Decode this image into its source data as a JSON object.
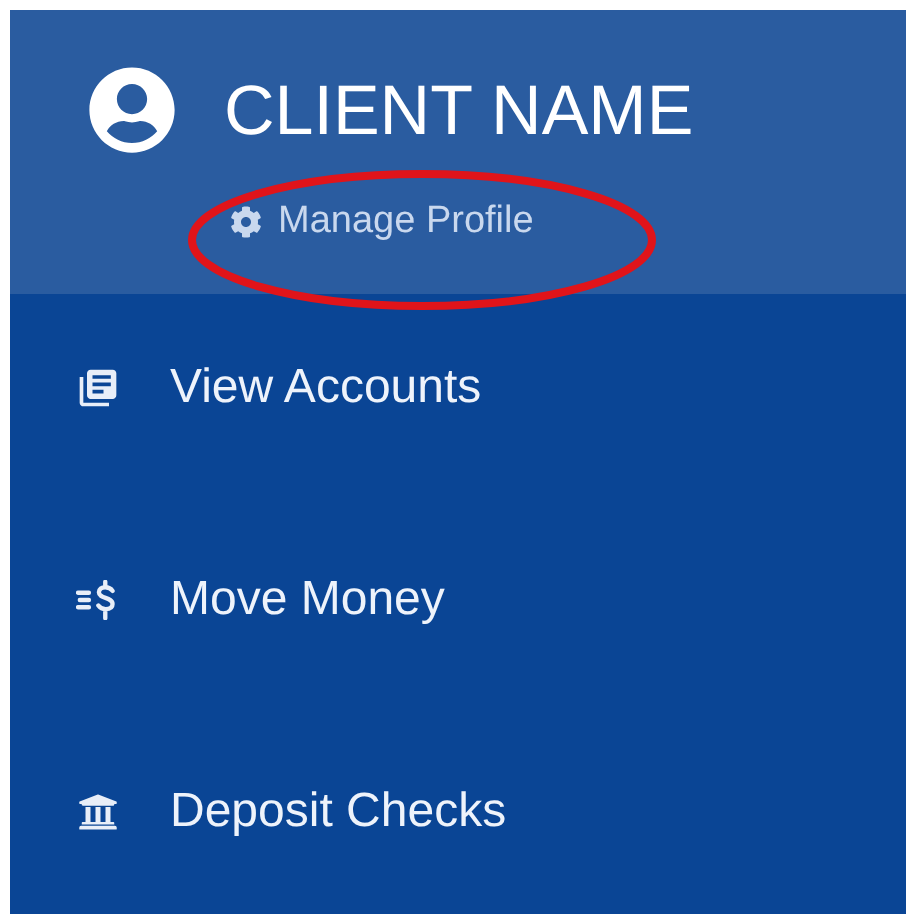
{
  "header": {
    "client_name": "CLIENT NAME",
    "manage_link": "Manage Profile",
    "highlighted": true
  },
  "menu": {
    "items": [
      {
        "kind": "accounts",
        "label": "View Accounts"
      },
      {
        "kind": "money",
        "label": "Move Money"
      },
      {
        "kind": "deposit",
        "label": "Deposit Checks"
      }
    ]
  }
}
